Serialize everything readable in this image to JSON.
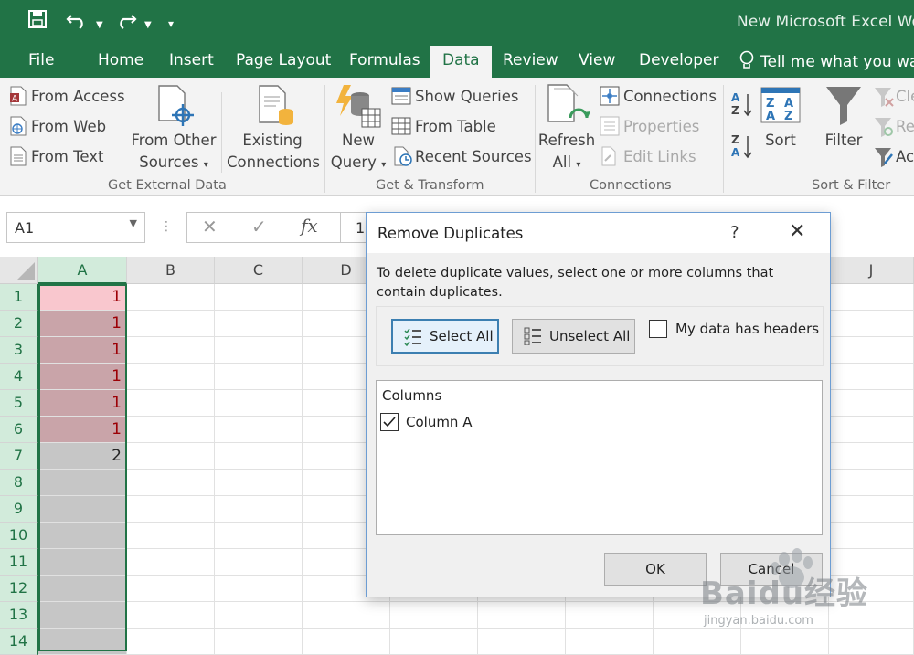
{
  "title": "New Microsoft Excel Wor",
  "tabs": [
    "File",
    "Home",
    "Insert",
    "Page Layout",
    "Formulas",
    "Data",
    "Review",
    "View",
    "Developer"
  ],
  "active_tab": "Data",
  "tell_me": "Tell me what you war",
  "ribbon": {
    "get_external_data": {
      "group_label": "Get External Data",
      "from_access": "From Access",
      "from_web": "From Web",
      "from_text": "From Text",
      "from_other_line1": "From Other",
      "from_other_line2": "Sources",
      "existing_line1": "Existing",
      "existing_line2": "Connections"
    },
    "get_transform": {
      "group_label": "Get & Transform",
      "new_query_line1": "New",
      "new_query_line2": "Query",
      "show_queries": "Show Queries",
      "from_table": "From Table",
      "recent_sources": "Recent Sources"
    },
    "connections": {
      "group_label": "Connections",
      "refresh_line1": "Refresh",
      "refresh_line2": "All",
      "connections": "Connections",
      "properties": "Properties",
      "edit_links": "Edit Links"
    },
    "sort_filter": {
      "group_label": "Sort & Filter",
      "sort": "Sort",
      "filter": "Filter",
      "clear": "Cle",
      "reapply": "Re",
      "advanced": "Ac"
    }
  },
  "formula_bar": {
    "name_box": "A1",
    "formula_value": "1"
  },
  "grid": {
    "columns": [
      "A",
      "B",
      "C",
      "D",
      "J"
    ],
    "rows": [
      "1",
      "2",
      "3",
      "4",
      "5",
      "6",
      "7",
      "8",
      "9",
      "10",
      "11",
      "12",
      "13",
      "14"
    ],
    "column_a_values": [
      "1",
      "1",
      "1",
      "1",
      "1",
      "1",
      "2",
      "",
      "",
      "",
      "",
      "",
      "",
      ""
    ]
  },
  "dialog": {
    "title": "Remove Duplicates",
    "help": "?",
    "instructions": "To delete duplicate values, select one or more columns that contain duplicates.",
    "select_all": "Select All",
    "unselect_all": "Unselect All",
    "has_headers_label": "My data has headers",
    "has_headers_checked": false,
    "columns_header": "Columns",
    "columns": [
      {
        "label": "Column A",
        "checked": true
      }
    ],
    "ok": "OK",
    "cancel": "Cancel"
  },
  "watermark": {
    "text": "Baidu经验",
    "url": "jingyan.baidu.com"
  },
  "colors": {
    "excel_green": "#217346",
    "dup_fill_first": "#f9c7ce",
    "dup_fill_selected": "#c9a4a9",
    "dup_text": "#9c0006",
    "selection_fill": "#c6c6c6"
  }
}
